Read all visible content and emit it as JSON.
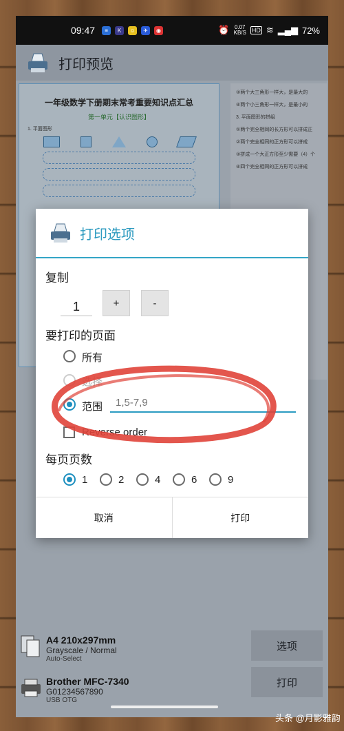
{
  "status_bar": {
    "time": "09:47",
    "net_speed_value": "0.07",
    "net_speed_unit": "KB/S",
    "hd": "HD",
    "battery": "72%"
  },
  "app_bar": {
    "title": "打印预览"
  },
  "preview": {
    "page1_title": "一年级数学下册期末常考重要知识点汇总",
    "page1_section": "第一单元【认识图形】",
    "page1_item": "1. 平面图形",
    "page2_lines": [
      "③两个大三角形一样大，是最大的",
      "④两个小三角形一样大，是最小的",
      "3. 平面图形的拼组",
      "①两个完全相同的长方形可以拼成正",
      "②两个完全相同的正方形可以拼成",
      "③拼成一个大正方形至少需要（4）个",
      "④四个完全相同的正方形可以拼成"
    ]
  },
  "dialog": {
    "title": "打印选项",
    "copies_label": "复制",
    "copies_value": "1",
    "plus_label": "+",
    "minus_label": "-",
    "pages_label": "要打印的页面",
    "option_all": "所有",
    "option_selection": "选择",
    "option_range": "范围",
    "range_placeholder": "1,5-7,9",
    "reverse_label": "Reverse order",
    "per_page_label": "每页页数",
    "per_page_options": [
      "1",
      "2",
      "4",
      "6",
      "9"
    ],
    "per_page_selected": "1",
    "cancel": "取消",
    "print": "打印"
  },
  "bottom": {
    "paper_size": "A4 210x297mm",
    "paper_mode": "Grayscale / Normal",
    "paper_select": "Auto-Select",
    "printer_name": "Brother MFC-7340",
    "printer_serial": "G01234567890",
    "printer_conn": "USB OTG",
    "options_button": "选项",
    "print_button": "打印"
  },
  "watermark": "头条 @月影雅韵",
  "colors": {
    "accent": "#2e9bc0",
    "annotation": "#e0443a"
  }
}
